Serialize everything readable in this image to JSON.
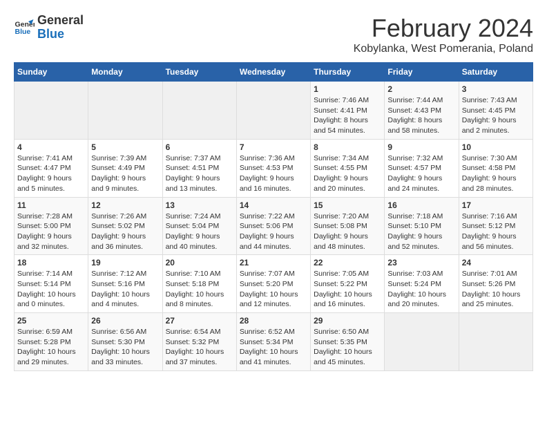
{
  "logo": {
    "line1": "General",
    "line2": "Blue"
  },
  "title": "February 2024",
  "subtitle": "Kobylanka, West Pomerania, Poland",
  "weekdays": [
    "Sunday",
    "Monday",
    "Tuesday",
    "Wednesday",
    "Thursday",
    "Friday",
    "Saturday"
  ],
  "weeks": [
    [
      {
        "day": "",
        "info": ""
      },
      {
        "day": "",
        "info": ""
      },
      {
        "day": "",
        "info": ""
      },
      {
        "day": "",
        "info": ""
      },
      {
        "day": "1",
        "info": "Sunrise: 7:46 AM\nSunset: 4:41 PM\nDaylight: 8 hours\nand 54 minutes."
      },
      {
        "day": "2",
        "info": "Sunrise: 7:44 AM\nSunset: 4:43 PM\nDaylight: 8 hours\nand 58 minutes."
      },
      {
        "day": "3",
        "info": "Sunrise: 7:43 AM\nSunset: 4:45 PM\nDaylight: 9 hours\nand 2 minutes."
      }
    ],
    [
      {
        "day": "4",
        "info": "Sunrise: 7:41 AM\nSunset: 4:47 PM\nDaylight: 9 hours\nand 5 minutes."
      },
      {
        "day": "5",
        "info": "Sunrise: 7:39 AM\nSunset: 4:49 PM\nDaylight: 9 hours\nand 9 minutes."
      },
      {
        "day": "6",
        "info": "Sunrise: 7:37 AM\nSunset: 4:51 PM\nDaylight: 9 hours\nand 13 minutes."
      },
      {
        "day": "7",
        "info": "Sunrise: 7:36 AM\nSunset: 4:53 PM\nDaylight: 9 hours\nand 16 minutes."
      },
      {
        "day": "8",
        "info": "Sunrise: 7:34 AM\nSunset: 4:55 PM\nDaylight: 9 hours\nand 20 minutes."
      },
      {
        "day": "9",
        "info": "Sunrise: 7:32 AM\nSunset: 4:57 PM\nDaylight: 9 hours\nand 24 minutes."
      },
      {
        "day": "10",
        "info": "Sunrise: 7:30 AM\nSunset: 4:58 PM\nDaylight: 9 hours\nand 28 minutes."
      }
    ],
    [
      {
        "day": "11",
        "info": "Sunrise: 7:28 AM\nSunset: 5:00 PM\nDaylight: 9 hours\nand 32 minutes."
      },
      {
        "day": "12",
        "info": "Sunrise: 7:26 AM\nSunset: 5:02 PM\nDaylight: 9 hours\nand 36 minutes."
      },
      {
        "day": "13",
        "info": "Sunrise: 7:24 AM\nSunset: 5:04 PM\nDaylight: 9 hours\nand 40 minutes."
      },
      {
        "day": "14",
        "info": "Sunrise: 7:22 AM\nSunset: 5:06 PM\nDaylight: 9 hours\nand 44 minutes."
      },
      {
        "day": "15",
        "info": "Sunrise: 7:20 AM\nSunset: 5:08 PM\nDaylight: 9 hours\nand 48 minutes."
      },
      {
        "day": "16",
        "info": "Sunrise: 7:18 AM\nSunset: 5:10 PM\nDaylight: 9 hours\nand 52 minutes."
      },
      {
        "day": "17",
        "info": "Sunrise: 7:16 AM\nSunset: 5:12 PM\nDaylight: 9 hours\nand 56 minutes."
      }
    ],
    [
      {
        "day": "18",
        "info": "Sunrise: 7:14 AM\nSunset: 5:14 PM\nDaylight: 10 hours\nand 0 minutes."
      },
      {
        "day": "19",
        "info": "Sunrise: 7:12 AM\nSunset: 5:16 PM\nDaylight: 10 hours\nand 4 minutes."
      },
      {
        "day": "20",
        "info": "Sunrise: 7:10 AM\nSunset: 5:18 PM\nDaylight: 10 hours\nand 8 minutes."
      },
      {
        "day": "21",
        "info": "Sunrise: 7:07 AM\nSunset: 5:20 PM\nDaylight: 10 hours\nand 12 minutes."
      },
      {
        "day": "22",
        "info": "Sunrise: 7:05 AM\nSunset: 5:22 PM\nDaylight: 10 hours\nand 16 minutes."
      },
      {
        "day": "23",
        "info": "Sunrise: 7:03 AM\nSunset: 5:24 PM\nDaylight: 10 hours\nand 20 minutes."
      },
      {
        "day": "24",
        "info": "Sunrise: 7:01 AM\nSunset: 5:26 PM\nDaylight: 10 hours\nand 25 minutes."
      }
    ],
    [
      {
        "day": "25",
        "info": "Sunrise: 6:59 AM\nSunset: 5:28 PM\nDaylight: 10 hours\nand 29 minutes."
      },
      {
        "day": "26",
        "info": "Sunrise: 6:56 AM\nSunset: 5:30 PM\nDaylight: 10 hours\nand 33 minutes."
      },
      {
        "day": "27",
        "info": "Sunrise: 6:54 AM\nSunset: 5:32 PM\nDaylight: 10 hours\nand 37 minutes."
      },
      {
        "day": "28",
        "info": "Sunrise: 6:52 AM\nSunset: 5:34 PM\nDaylight: 10 hours\nand 41 minutes."
      },
      {
        "day": "29",
        "info": "Sunrise: 6:50 AM\nSunset: 5:35 PM\nDaylight: 10 hours\nand 45 minutes."
      },
      {
        "day": "",
        "info": ""
      },
      {
        "day": "",
        "info": ""
      }
    ]
  ]
}
